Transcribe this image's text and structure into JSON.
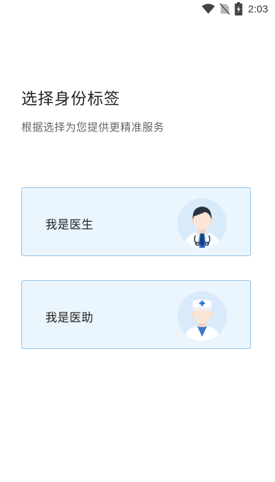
{
  "status_bar": {
    "time": "2:03",
    "icons": [
      "wifi-icon",
      "no-sim-icon",
      "battery-charging-icon"
    ]
  },
  "header": {
    "title": "选择身份标签",
    "subtitle": "根据选择为您提供更精准服务"
  },
  "roles": [
    {
      "label": "我是医生",
      "avatar": "doctor-avatar-icon"
    },
    {
      "label": "我是医助",
      "avatar": "nurse-avatar-icon"
    }
  ],
  "colors": {
    "card_background": "#ebf5fd",
    "card_border": "#93c1e6",
    "avatar_circle": "#d9ebfa",
    "accent_blue": "#2e6fc4"
  }
}
